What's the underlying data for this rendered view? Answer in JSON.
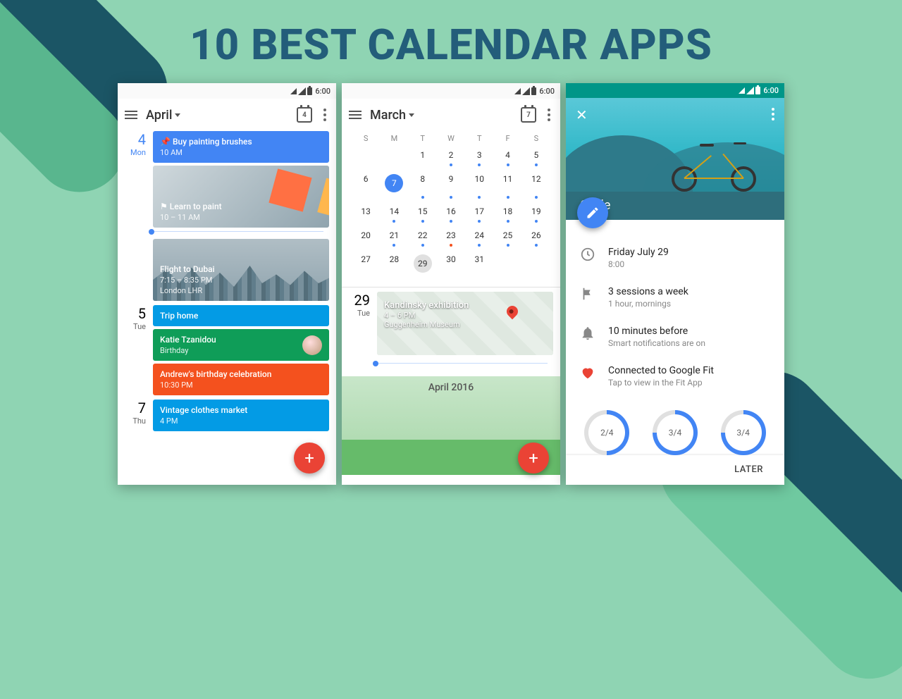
{
  "title": "10 BEST CALENDAR APPS",
  "status": {
    "time": "6:00"
  },
  "phoneA": {
    "month": "April",
    "today_badge": "4",
    "days": [
      {
        "num": "4",
        "dow": "Mon",
        "today": true
      },
      {
        "num": "5",
        "dow": "Tue"
      },
      {
        "num": "7",
        "dow": "Thu"
      }
    ],
    "events": {
      "d4": [
        {
          "title": "Buy painting brushes",
          "sub": "10 AM"
        },
        {
          "title": "Learn to paint",
          "sub": "10 – 11 AM"
        },
        {
          "title": "Flight to Dubai",
          "sub": "7:15 – 8:35 PM",
          "sub2": "London LHR"
        }
      ],
      "d5": [
        {
          "title": "Trip home"
        },
        {
          "title": "Katie Tzanidou",
          "sub": "Birthday"
        },
        {
          "title": "Andrew's birthday celebration",
          "sub": "10:30 PM"
        }
      ],
      "d7": [
        {
          "title": "Vintage clothes market",
          "sub": "4 PM"
        }
      ]
    }
  },
  "phoneB": {
    "month": "March",
    "today_badge": "7",
    "weekdays": [
      "S",
      "M",
      "T",
      "W",
      "T",
      "F",
      "S"
    ],
    "grid": [
      [
        {
          "n": "",
          "out": true
        },
        {
          "n": "",
          "out": true
        },
        {
          "n": "1"
        },
        {
          "n": "2",
          "dot": "b"
        },
        {
          "n": "3",
          "dot": "b"
        },
        {
          "n": "4",
          "dot": "b"
        },
        {
          "n": "5",
          "dot": "b"
        }
      ],
      [
        {
          "n": "6"
        },
        {
          "n": "7",
          "sel": true
        },
        {
          "n": "8",
          "dot": "b"
        },
        {
          "n": "9",
          "dot": "b"
        },
        {
          "n": "10",
          "dot": "b"
        },
        {
          "n": "11",
          "dot": "b"
        },
        {
          "n": "12",
          "dot": "b"
        }
      ],
      [
        {
          "n": "13"
        },
        {
          "n": "14",
          "dot": "b"
        },
        {
          "n": "15",
          "dot": "b"
        },
        {
          "n": "16",
          "dot": "b"
        },
        {
          "n": "17",
          "dot": "b"
        },
        {
          "n": "18",
          "dot": "b"
        },
        {
          "n": "19",
          "dot": "b"
        }
      ],
      [
        {
          "n": "20"
        },
        {
          "n": "21",
          "dot": "b"
        },
        {
          "n": "22",
          "dot": "b"
        },
        {
          "n": "23",
          "dot": "o"
        },
        {
          "n": "24",
          "dot": "b"
        },
        {
          "n": "25",
          "dot": "b"
        },
        {
          "n": "26",
          "dot": "b"
        }
      ],
      [
        {
          "n": "27"
        },
        {
          "n": "28"
        },
        {
          "n": "29",
          "tod": true
        },
        {
          "n": "30"
        },
        {
          "n": "31"
        },
        {
          "n": "",
          "out": true
        },
        {
          "n": "",
          "out": true
        }
      ]
    ],
    "selected_day": {
      "num": "29",
      "dow": "Tue"
    },
    "event": {
      "title": "Kandinsky exhibition",
      "sub": "4 – 6 PM",
      "loc": "Guggenheim Museum"
    },
    "next_month": "April 2016"
  },
  "phoneC": {
    "title": "Cycle",
    "rows": [
      {
        "primary": "Friday July 29",
        "sub": "8:00"
      },
      {
        "primary": "3 sessions a week",
        "sub": "1 hour, mornings"
      },
      {
        "primary": "10 minutes before",
        "sub": "Smart notifications are on"
      },
      {
        "primary": "Connected to Google Fit",
        "sub": "Tap to view in the Fit App"
      }
    ],
    "rings": [
      "2/4",
      "3/4",
      "3/4"
    ],
    "later": "LATER"
  }
}
